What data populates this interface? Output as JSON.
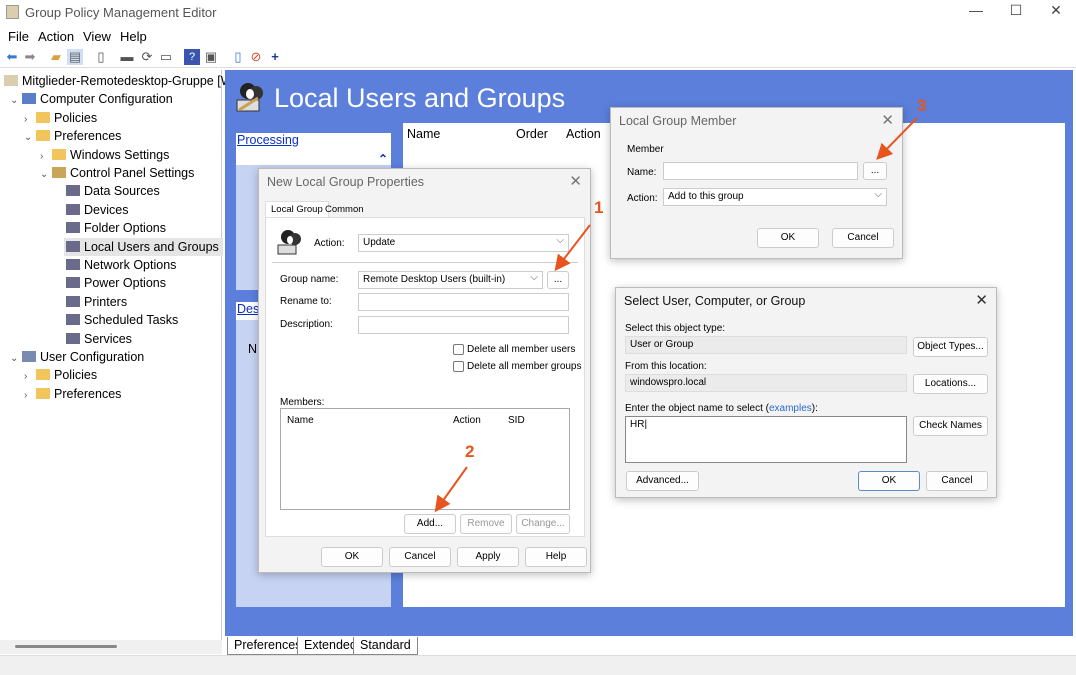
{
  "window": {
    "title": "Group Policy Management Editor",
    "minimize": "—",
    "maximize": "☐",
    "close": "✕"
  },
  "menu": [
    "File",
    "Action",
    "View",
    "Help"
  ],
  "toolbar": [
    "back-icon",
    "forward-icon",
    "up-folder-icon",
    "show-hide-tree-icon",
    "clipboard-icon",
    "print-icon",
    "refresh-icon",
    "export-icon",
    "help-icon",
    "console-icon",
    "document-icon",
    "stop-icon",
    "add-icon"
  ],
  "tree": {
    "items": [
      {
        "label": "Mitglieder-Remotedesktop-Gruppe [WS",
        "chev": ""
      },
      {
        "label": "Computer Configuration",
        "chev": "⌄"
      },
      {
        "label": "Policies",
        "chev": "›"
      },
      {
        "label": "Preferences",
        "chev": "⌄"
      },
      {
        "label": "Windows Settings",
        "chev": "›"
      },
      {
        "label": "Control Panel Settings",
        "chev": "⌄"
      },
      {
        "label": "Data Sources",
        "chev": ""
      },
      {
        "label": "Devices",
        "chev": ""
      },
      {
        "label": "Folder Options",
        "chev": ""
      },
      {
        "label": "Local Users and Groups",
        "chev": "",
        "selected": true
      },
      {
        "label": "Network Options",
        "chev": ""
      },
      {
        "label": "Power Options",
        "chev": ""
      },
      {
        "label": "Printers",
        "chev": ""
      },
      {
        "label": "Scheduled Tasks",
        "chev": ""
      },
      {
        "label": "Services",
        "chev": ""
      },
      {
        "label": "User Configuration",
        "chev": "⌄"
      },
      {
        "label": "Policies",
        "chev": "›"
      },
      {
        "label": "Preferences",
        "chev": "›"
      }
    ]
  },
  "main": {
    "title": "Local Users and Groups",
    "processing": "Processing",
    "description": "Desc",
    "desc_text": "N",
    "columns": [
      "Name",
      "Order",
      "Action"
    ],
    "tabs": [
      "Preferences",
      "Extended",
      "Standard"
    ],
    "accent": "#5b7fdb"
  },
  "group_props": {
    "title": "New Local Group Properties",
    "tabs": [
      "Local Group",
      "Common"
    ],
    "action_label": "Action:",
    "action_value": "Update",
    "group_name_label": "Group name:",
    "group_name_value": "Remote Desktop Users (built-in)",
    "browse": "...",
    "rename_label": "Rename to:",
    "description_label": "Description:",
    "delete_users": "Delete all member users",
    "delete_groups": "Delete all member groups",
    "members_label": "Members:",
    "members_columns": [
      "Name",
      "Action",
      "SID"
    ],
    "add": "Add...",
    "remove": "Remove",
    "change": "Change...",
    "ok": "OK",
    "cancel": "Cancel",
    "apply": "Apply",
    "help": "Help"
  },
  "member_dialog": {
    "title": "Local Group Member",
    "group": "Member",
    "name_label": "Name:",
    "name_value": "",
    "browse": "...",
    "action_label": "Action:",
    "action_value": "Add to this group",
    "ok": "OK",
    "cancel": "Cancel"
  },
  "select_dialog": {
    "title": "Select User, Computer, or Group",
    "object_type_label": "Select this object type:",
    "object_type": "User or Group",
    "object_types_btn": "Object Types...",
    "location_label": "From this location:",
    "location": "windowspro.local",
    "locations_btn": "Locations...",
    "enter_label_pre": "Enter the object name to select (",
    "examples": "examples",
    "enter_label_post": "):",
    "object_name": "HR",
    "check_names": "Check Names",
    "advanced": "Advanced...",
    "ok": "OK",
    "cancel": "Cancel"
  },
  "annotations": {
    "labels": [
      "1",
      "2",
      "3"
    ],
    "color": "#e8541e"
  }
}
